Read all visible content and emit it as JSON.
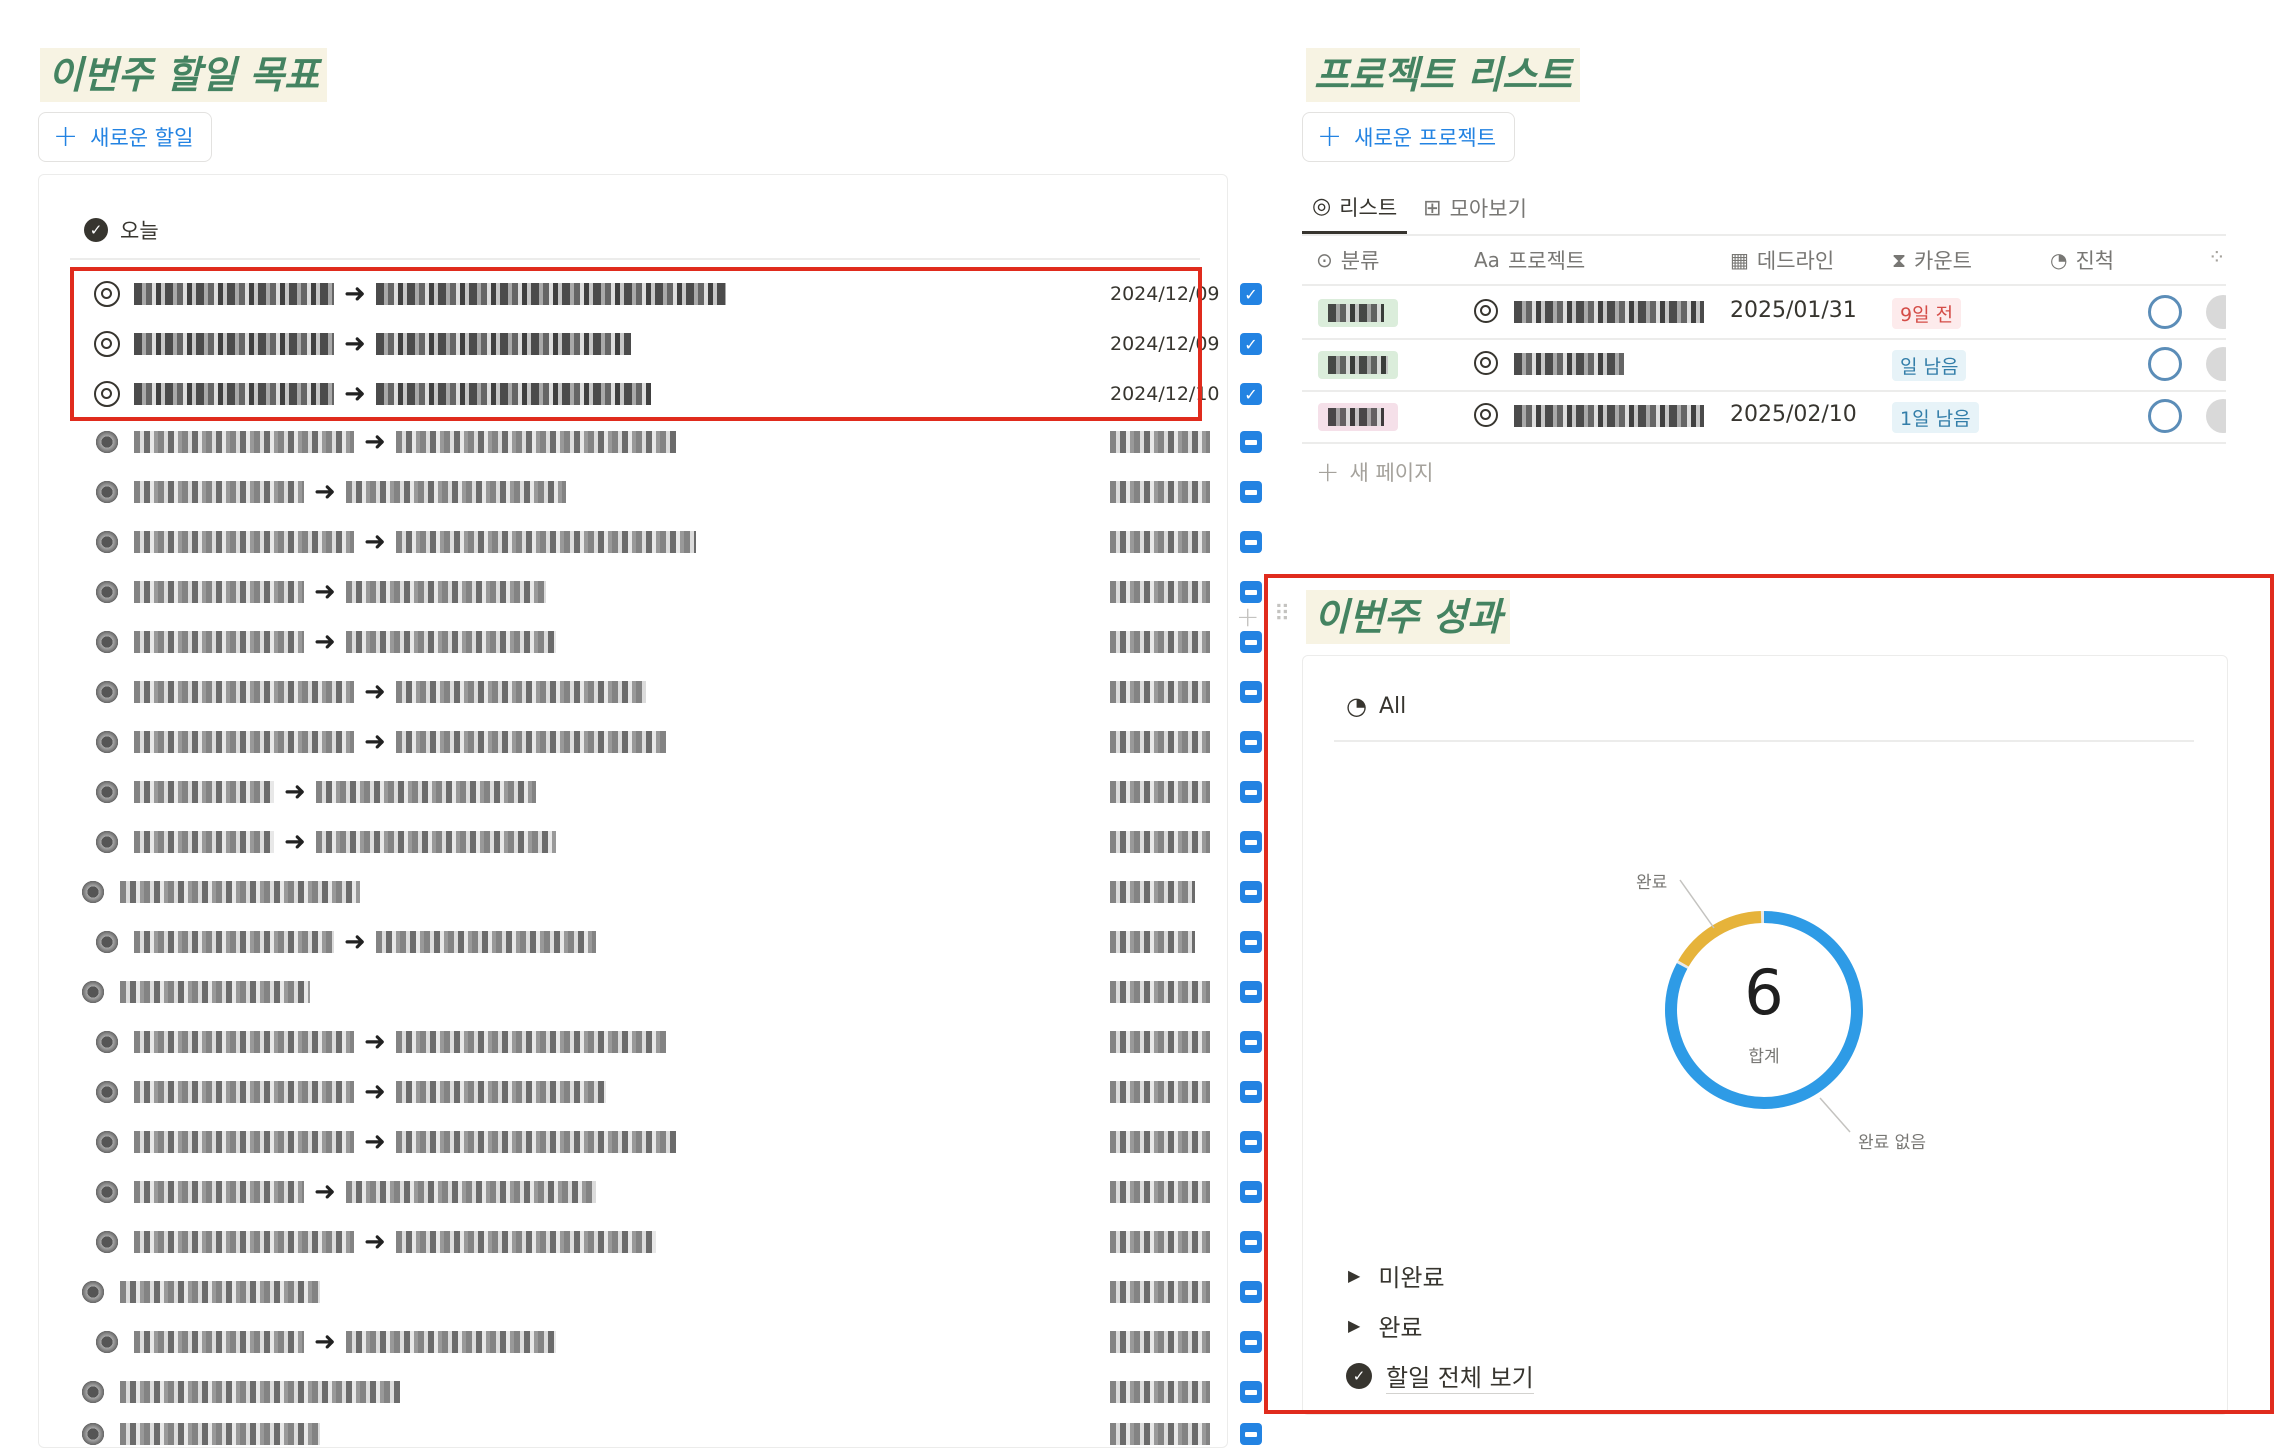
{
  "left": {
    "heading": "이번주 할일 목표",
    "new_button": "새로운 할일",
    "group": "오늘",
    "rows": [
      {
        "date": "2024/12/09",
        "checked": true
      },
      {
        "date": "2024/12/09",
        "checked": true
      },
      {
        "date": "2024/12/10",
        "checked": true
      }
    ]
  },
  "right": {
    "heading": "프로젝트 리스트",
    "new_button": "새로운 프로젝트",
    "tabs": [
      {
        "label": "리스트",
        "icon": "target-icon"
      },
      {
        "label": "모아보기",
        "icon": "gallery-icon"
      }
    ],
    "columns": [
      {
        "label": "분류",
        "icon": "select-icon"
      },
      {
        "label": "프로젝트",
        "icon": "text-icon"
      },
      {
        "label": "데드라인",
        "icon": "calendar-icon"
      },
      {
        "label": "카운트",
        "icon": "hourglass-icon"
      },
      {
        "label": "진척",
        "icon": "progress-icon"
      }
    ],
    "projects": [
      {
        "deadline": "2025/01/31",
        "count": "9일 전",
        "count_color": "red",
        "tag_color": "#dbeddb"
      },
      {
        "deadline": "",
        "count": "일 남음",
        "count_color": "blue",
        "tag_color": "#dbeddb"
      },
      {
        "deadline": "2025/02/10",
        "count": "1일 남음",
        "count_color": "blue",
        "tag_color": "#f5e0e9"
      }
    ],
    "new_page": "새 페이지"
  },
  "performance": {
    "heading": "이번주 성과",
    "tab": "All",
    "total": "6",
    "total_label": "합계",
    "label_done": "완료",
    "label_not_done": "완료 없음",
    "toggles": [
      "미완료",
      "완료"
    ],
    "view_all": "할일 전체 보기",
    "accent": "#2e9be6",
    "done_color": "#e6b33a"
  }
}
